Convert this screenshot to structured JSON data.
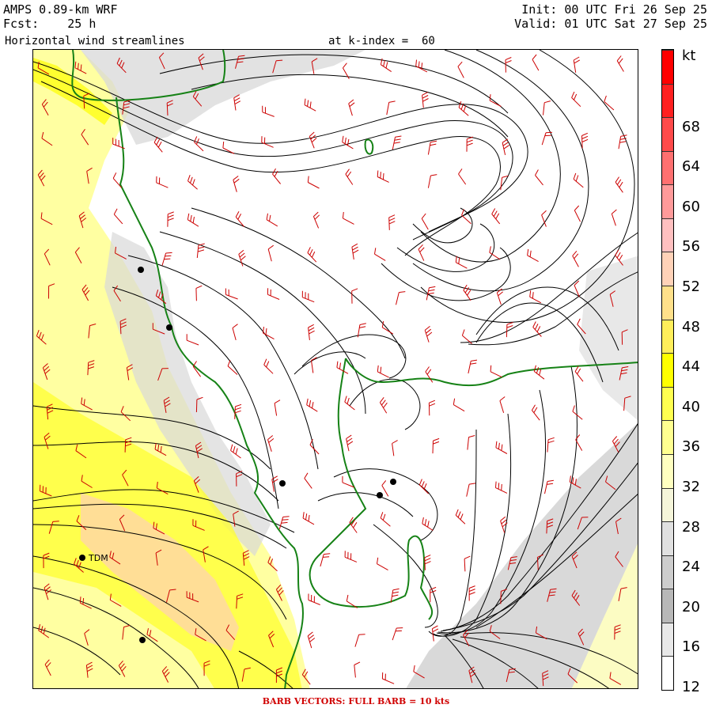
{
  "header": {
    "model": "AMPS 0.89-km WRF",
    "forecast": "Fcst:    25 h",
    "product": "Horizontal wind streamlines",
    "level": "at k-index =  60",
    "init": "Init: 00 UTC Fri 26 Sep 25",
    "valid": "Valid: 01 UTC Sat 27 Sep 25"
  },
  "colorbar": {
    "unit": "kt",
    "tick_labels": [
      "68",
      "64",
      "60",
      "56",
      "52",
      "48",
      "44",
      "40",
      "36",
      "32",
      "28",
      "24",
      "20",
      "16",
      "12"
    ],
    "colors": [
      "#ff0000",
      "#ff2020",
      "#ff4a4a",
      "#ff7070",
      "#ff9a9a",
      "#ffc0c0",
      "#ffd2b8",
      "#ffe08a",
      "#ffee5a",
      "#ffff00",
      "#ffff50",
      "#ffff90",
      "#ffffc0",
      "#f5f5da",
      "#e0e0e0",
      "#cdcdcd",
      "#b8b8b8",
      "#e8e8e8",
      "#ffffff"
    ]
  },
  "footer": "BARB VECTORS:  FULL BARB = 10 kts",
  "stations": [
    {
      "label": ""
    },
    {
      "label": ""
    },
    {
      "label": ""
    },
    {
      "label": ""
    },
    {
      "label": ""
    },
    {
      "label": "TDM"
    },
    {
      "label": ""
    }
  ],
  "colors": {
    "coastline": "#168216",
    "barb": "#cc0000",
    "streamline": "#000000",
    "footer_text": "#d00000"
  }
}
